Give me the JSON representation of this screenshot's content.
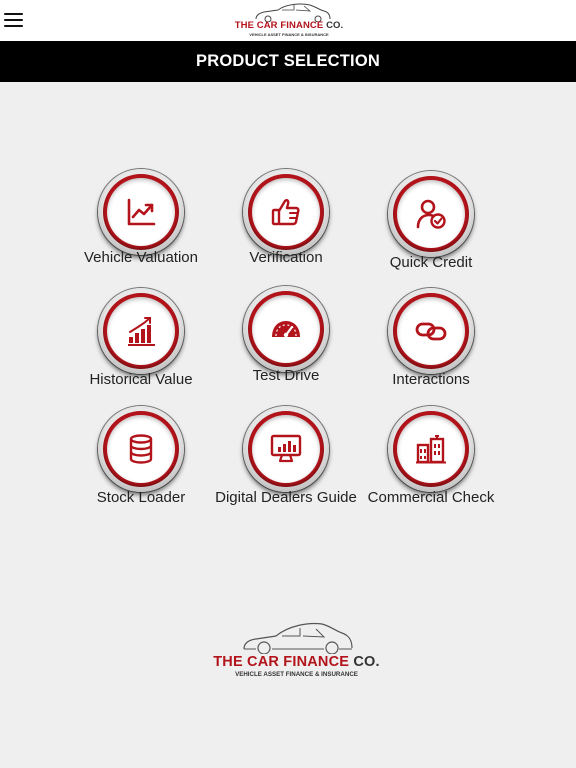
{
  "header": {
    "menu_icon": "hamburger-menu-icon",
    "logo": {
      "title_main": "THE CAR FINANCE",
      "title_co": "CO.",
      "subtitle": "VEHICLE ASSET FINANCE & INSURANCE"
    }
  },
  "title_bar": {
    "title": "PRODUCT SELECTION"
  },
  "products": [
    {
      "label": "Vehicle Valuation",
      "icon": "chart-up-icon"
    },
    {
      "label": "Verification",
      "icon": "thumbs-up-icon"
    },
    {
      "label": "Quick Credit",
      "icon": "user-check-icon"
    },
    {
      "label": "Historical Value",
      "icon": "bar-chart-up-icon"
    },
    {
      "label": "Test Drive",
      "icon": "speedometer-icon"
    },
    {
      "label": "Interactions",
      "icon": "link-icon"
    },
    {
      "label": "Stock Loader",
      "icon": "database-icon"
    },
    {
      "label": "Digital Dealers Guide",
      "icon": "monitor-chart-icon"
    },
    {
      "label": "Commercial Check",
      "icon": "buildings-icon"
    }
  ],
  "footer": {
    "logo": {
      "title_main": "THE CAR FINANCE",
      "title_co": "CO.",
      "subtitle": "VEHICLE ASSET FINANCE & INSURANCE"
    }
  },
  "colors": {
    "brand_red": "#b3141b",
    "title_bar_bg": "#000000",
    "background": "#efefef"
  }
}
